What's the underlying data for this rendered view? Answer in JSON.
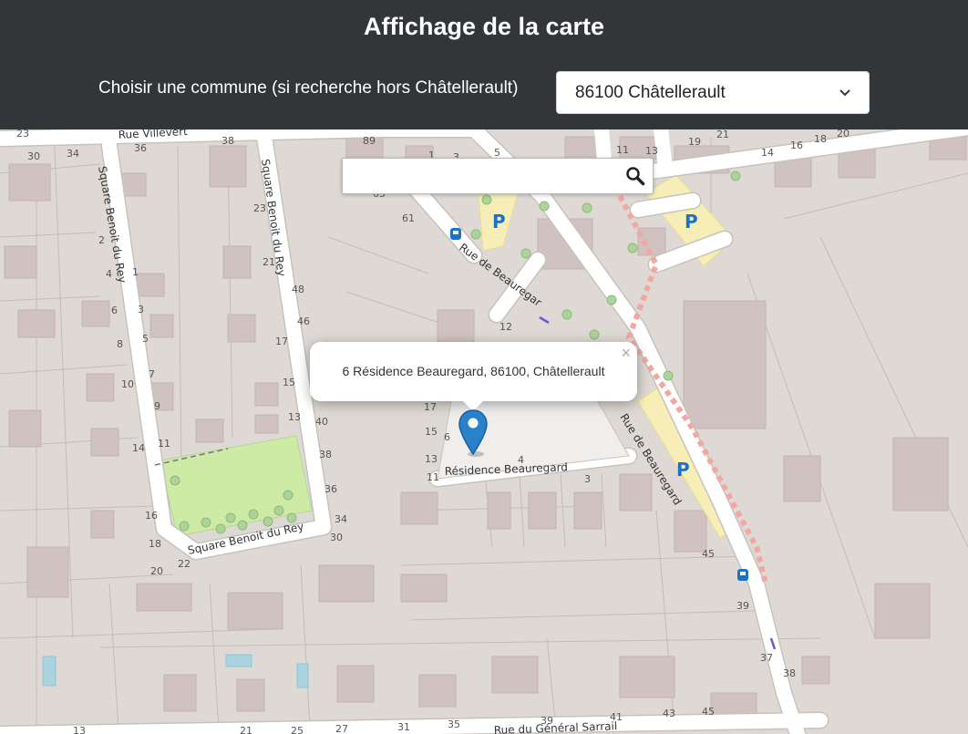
{
  "header": {
    "title": "Affichage de la carte",
    "commune_label": "Choisir une commune (si recherche hors Châtellerault)",
    "commune_selected": "86100 Châtellerault"
  },
  "map": {
    "search": {
      "value": "",
      "placeholder": ""
    },
    "popup": {
      "address": "6 Résidence Beauregard, 86100, Châtellerault",
      "close": "×"
    },
    "streets": {
      "villevert": "Rue Villevert",
      "benoit_left": "Square Benoit du Rey",
      "benoit_right": "Square Benoit du Rey",
      "benoit_bottom": "Square Benoit du Rey",
      "beauregard_upper": "Rue de Beauregar",
      "beauregard_lower": "Rue de Beauregard",
      "residence": "Résidence Beauregard",
      "general_sarrail": "Rue du Général Sarrail"
    },
    "house_numbers": {
      "n_23a": "23",
      "n_30": "30",
      "n_34": "34",
      "n_36": "36",
      "n_38a": "38",
      "n_89": "89",
      "n_1": "1",
      "n_3": "3",
      "n_5": "5",
      "n_11": "11",
      "n_13": "13",
      "n_19": "19",
      "n_21": "21",
      "n_14": "14",
      "n_16": "16",
      "n_18": "18",
      "n_20": "20",
      "n_2": "2",
      "n_4": "4",
      "n_6": "6",
      "n_8": "8",
      "n_10": "10",
      "n_14b": "14",
      "n_16b": "16",
      "n_18b": "18",
      "n_20b": "20",
      "n_22": "22",
      "n_1b": "1",
      "n_3b": "3",
      "n_5b": "5",
      "n_7": "7",
      "n_9": "9",
      "n_11b": "11",
      "n_23b": "23",
      "n_21b": "21",
      "n_48": "48",
      "n_46": "46",
      "n_17": "17",
      "n_15": "15",
      "n_13b": "13",
      "n_40": "40",
      "n_38b": "38",
      "n_36b": "36",
      "n_34b": "34",
      "n_30b": "30",
      "n_61": "61",
      "n_65": "65",
      "n_12": "12",
      "n_17b": "17",
      "n_15b": "15",
      "n_13c": "13",
      "n_11c": "11",
      "n_6b": "6",
      "n_4b": "4",
      "n_3c": "3",
      "n_45": "45",
      "n_39": "39",
      "n_37": "37",
      "n_38c": "38",
      "n_41": "41",
      "n_43": "43",
      "n_45b": "45",
      "n_39b": "39",
      "n_35": "35",
      "n_31": "31",
      "n_27": "27",
      "n_25": "25",
      "n_21c": "21",
      "n_13d": "13"
    }
  }
}
